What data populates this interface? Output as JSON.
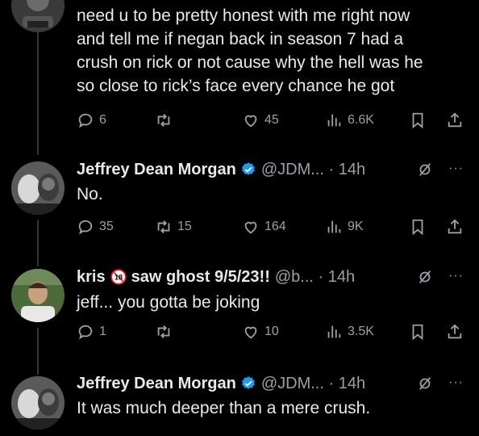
{
  "tweets": [
    {
      "text_lines": [
        "need u to be pretty honest with me right now",
        "and tell me if negan back in season 7 had a",
        "crush on rick or not cause why the hell was he",
        "so close to rick’s face every chance he got"
      ],
      "replies": "6",
      "reposts": "",
      "likes": "45",
      "views": "6.6K"
    },
    {
      "name": "Jeffrey Dean Morgan",
      "handle": "@JDM... · 14h",
      "text": "No.",
      "replies": "35",
      "reposts": "15",
      "likes": "164",
      "views": "9K"
    },
    {
      "name": "kris",
      "badge": "18",
      "name_suffix": "saw ghost 9/5/23!!",
      "handle": "@b... · 14h",
      "text": "jeff... you gotta be joking",
      "replies": "1",
      "reposts": "",
      "likes": "10",
      "views": "3.5K"
    },
    {
      "name": "Jeffrey Dean Morgan",
      "handle": "@JDM... · 14h",
      "text": "It was much deeper than a mere crush."
    }
  ],
  "more_glyph": "···",
  "colors": {
    "background": "#000000",
    "text": "#e7e9ea",
    "muted": "#9aa0a6",
    "verified": "#1d9bf0",
    "badge": "#f4212e"
  }
}
